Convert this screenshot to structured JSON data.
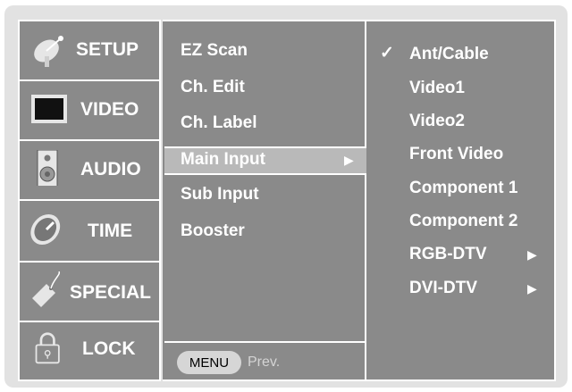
{
  "categories": [
    {
      "label": "SETUP",
      "icon": "satellite-dish-icon"
    },
    {
      "label": "VIDEO",
      "icon": "monitor-icon"
    },
    {
      "label": "AUDIO",
      "icon": "speaker-icon"
    },
    {
      "label": "TIME",
      "icon": "clock-icon"
    },
    {
      "label": "SPECIAL",
      "icon": "tag-icon"
    },
    {
      "label": "LOCK",
      "icon": "padlock-icon"
    }
  ],
  "setup_menu": {
    "items": [
      "EZ Scan",
      "Ch. Edit",
      "Ch. Label",
      "Main Input",
      "Sub Input",
      "Booster"
    ],
    "selected_index": 3,
    "arrow": "▶"
  },
  "submenu": {
    "items": [
      "Ant/Cable",
      "Video1",
      "Video2",
      "Front Video",
      "Component 1",
      "Component 2",
      "RGB-DTV",
      "DVI-DTV"
    ],
    "checked_index": 0,
    "checkmark": "✓",
    "arrow": "▶"
  },
  "footer": {
    "menu_button": "MENU",
    "prev_label": "Prev."
  },
  "colors": {
    "panel": "#8a8a8a",
    "highlight": "#b9b9b9",
    "frame": "#e2e2e2"
  }
}
